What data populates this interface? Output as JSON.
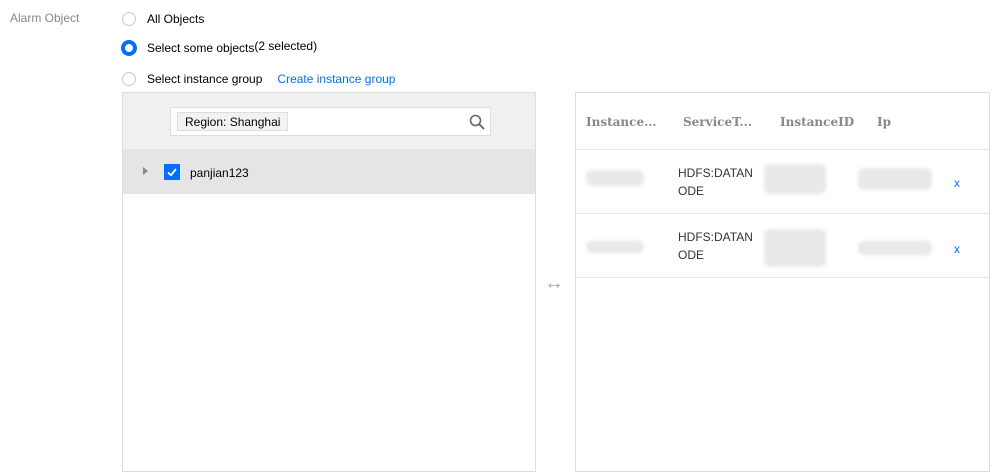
{
  "form": {
    "label": "Alarm Object",
    "options": [
      {
        "label": "All Objects",
        "selected": false
      },
      {
        "label": "Select some objects",
        "suffix": "(2 selected)",
        "selected": true
      },
      {
        "label": "Select instance group",
        "selected": false
      }
    ],
    "create_group_link": "Create instance group"
  },
  "left_panel": {
    "region_tag": "Region: Shanghai",
    "tree": [
      {
        "label": "panjian123",
        "checked": true
      }
    ]
  },
  "right_panel": {
    "columns": [
      "Instance...",
      "ServiceT...",
      "InstanceID",
      "Ip"
    ],
    "rows": [
      {
        "service_line1": "HDFS:DATAN",
        "service_line2": "ODE",
        "remove": "x"
      },
      {
        "service_line1": "HDFS:DATAN",
        "service_line2": "ODE",
        "remove": "x"
      }
    ]
  },
  "colors": {
    "accent": "#006eff",
    "border": "#dddddd",
    "row_bg": "#e5e5e5"
  }
}
